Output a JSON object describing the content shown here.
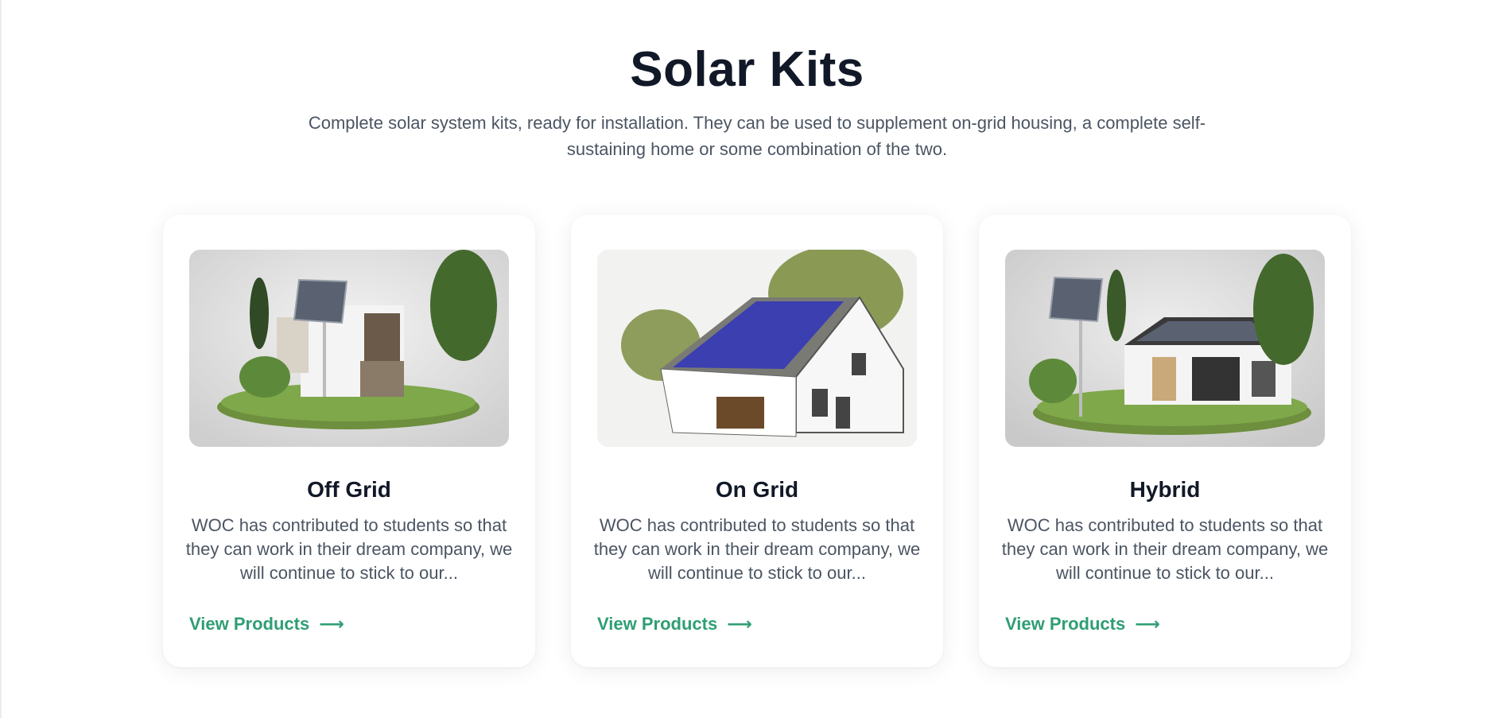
{
  "section": {
    "title": "Solar Kits",
    "subtitle": "Complete solar system kits, ready for installation. They can be used to supplement on-grid housing, a complete self-sustaining home or some combination of the two."
  },
  "cards": [
    {
      "title": "Off Grid",
      "description": "WOC has contributed to students so that they can work in their dream company, we will continue to stick to our...",
      "link_label": "View Products",
      "link_icon": "arrow-right-icon"
    },
    {
      "title": "On Grid",
      "description": "WOC has contributed to students so that they can work in their dream company, we will continue to stick to our...",
      "link_label": "View Products",
      "link_icon": "arrow-right-icon"
    },
    {
      "title": "Hybrid",
      "description": "WOC has contributed to students so that they can work in their dream company, we will continue to stick to our...",
      "link_label": "View Products",
      "link_icon": "arrow-right-icon"
    }
  ],
  "colors": {
    "accent": "#2f9e74",
    "heading": "#111827",
    "body_text": "#4b5563"
  }
}
